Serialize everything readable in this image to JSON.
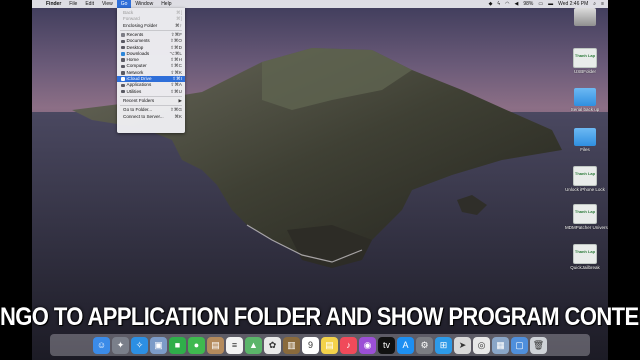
{
  "menubar": {
    "apple": "",
    "items": [
      {
        "label": "Finder",
        "bold": true
      },
      {
        "label": "File"
      },
      {
        "label": "Edit"
      },
      {
        "label": "View"
      },
      {
        "label": "Go",
        "active": true
      },
      {
        "label": "Window"
      },
      {
        "label": "Help"
      }
    ],
    "battery": "98%",
    "clock": "Wed 2:46 PM"
  },
  "go_menu": {
    "items": [
      {
        "label": "Back",
        "shortcut": "⌘[",
        "dim": true,
        "icon": false
      },
      {
        "label": "Forward",
        "shortcut": "⌘]",
        "dim": true,
        "icon": false
      },
      {
        "label": "Enclosing Folder",
        "shortcut": "⌘↑",
        "icon": false
      },
      {
        "sep": true
      },
      {
        "label": "Recents",
        "shortcut": "⇧⌘F",
        "icon": true,
        "color": "#7d7d86"
      },
      {
        "label": "Documents",
        "shortcut": "⇧⌘O",
        "icon": true,
        "color": "#5a5a64"
      },
      {
        "label": "Desktop",
        "shortcut": "⇧⌘D",
        "icon": true,
        "color": "#5a5a64"
      },
      {
        "label": "Downloads",
        "shortcut": "⌥⌘L",
        "icon": true,
        "color": "#2c86d9"
      },
      {
        "label": "Home",
        "shortcut": "⇧⌘H",
        "icon": true,
        "color": "#5a5a64"
      },
      {
        "label": "Computer",
        "shortcut": "⇧⌘C",
        "icon": true,
        "color": "#5a5a64"
      },
      {
        "label": "Network",
        "shortcut": "⇧⌘K",
        "icon": true,
        "color": "#5a5a64"
      },
      {
        "label": "iCloud Drive",
        "shortcut": "⇧⌘I",
        "icon": true,
        "color": "#ffffff",
        "highlight": true
      },
      {
        "label": "Applications",
        "shortcut": "⇧⌘A",
        "icon": true,
        "color": "#5a5a64"
      },
      {
        "label": "Utilities",
        "shortcut": "⇧⌘U",
        "icon": true,
        "color": "#5a5a64"
      },
      {
        "sep": true
      },
      {
        "label": "Recent Folders",
        "shortcut": "▶",
        "icon": false
      },
      {
        "sep": true
      },
      {
        "label": "Go to Folder...",
        "shortcut": "⇧⌘G",
        "icon": false
      },
      {
        "label": "Connect to Server...",
        "shortcut": "⌘K",
        "icon": false
      }
    ]
  },
  "desktop_icons": [
    {
      "label": "",
      "kind": "disk"
    },
    {
      "label": "USBFolder",
      "kind": "app",
      "badge": "Thanh Lap"
    },
    {
      "label": "Serial back up",
      "kind": "folder"
    },
    {
      "label": "Files",
      "kind": "folder"
    },
    {
      "label": "Unlock iPhone Lock",
      "kind": "app",
      "badge": "Thanh Lap"
    },
    {
      "label": "MDMPatcher Universal",
      "kind": "app",
      "badge": "Thanh Lap"
    },
    {
      "label": "QuickJailbreak",
      "kind": "app",
      "badge": "Thanh Lap"
    }
  ],
  "caption": "NGO TO APPLICATION FOLDER AND SHOW PROGRAM CONTENT",
  "dock": [
    {
      "name": "finder",
      "color": "#3b8be8",
      "glyph": "☺"
    },
    {
      "name": "launchpad",
      "color": "#7a7f8a",
      "glyph": "✦"
    },
    {
      "name": "safari",
      "color": "#2c8fe3",
      "glyph": "✧"
    },
    {
      "name": "preview",
      "color": "#7c9bc8",
      "glyph": "▣"
    },
    {
      "name": "facetime",
      "color": "#2fae4a",
      "glyph": "■"
    },
    {
      "name": "messages",
      "color": "#3fb94f",
      "glyph": "●"
    },
    {
      "name": "contacts",
      "color": "#b48a5c",
      "glyph": "▤"
    },
    {
      "name": "reminders",
      "color": "#f2f2f2",
      "glyph": "≡"
    },
    {
      "name": "maps",
      "color": "#5bb56a",
      "glyph": "▲"
    },
    {
      "name": "photos",
      "color": "#e9e9e9",
      "glyph": "✿"
    },
    {
      "name": "notes",
      "color": "#8a6a3c",
      "glyph": "▥"
    },
    {
      "name": "calendar",
      "color": "#ffffff",
      "glyph": "9"
    },
    {
      "name": "stickies",
      "color": "#f3d24a",
      "glyph": "▤"
    },
    {
      "name": "music",
      "color": "#f04a5a",
      "glyph": "♪"
    },
    {
      "name": "podcasts",
      "color": "#9b4fd6",
      "glyph": "◉"
    },
    {
      "name": "tv",
      "color": "#111111",
      "glyph": "tv"
    },
    {
      "name": "app-store",
      "color": "#1d8ff2",
      "glyph": "A"
    },
    {
      "name": "system-preferences",
      "color": "#7b7d83",
      "glyph": "⚙"
    },
    {
      "name": "utility-app",
      "color": "#2d9ae8",
      "glyph": "⊞"
    },
    {
      "name": "pointer-app",
      "color": "#d9d9d9",
      "glyph": "➤"
    },
    {
      "name": "chrome",
      "color": "#e8e8e8",
      "glyph": "◎"
    },
    {
      "name": "image-app",
      "color": "#8aa6c8",
      "glyph": "▦"
    },
    {
      "name": "finder-window",
      "color": "#4f8fdc",
      "glyph": "▢"
    },
    {
      "name": "trash",
      "color": "#cfd3d8",
      "glyph": "🗑"
    }
  ]
}
